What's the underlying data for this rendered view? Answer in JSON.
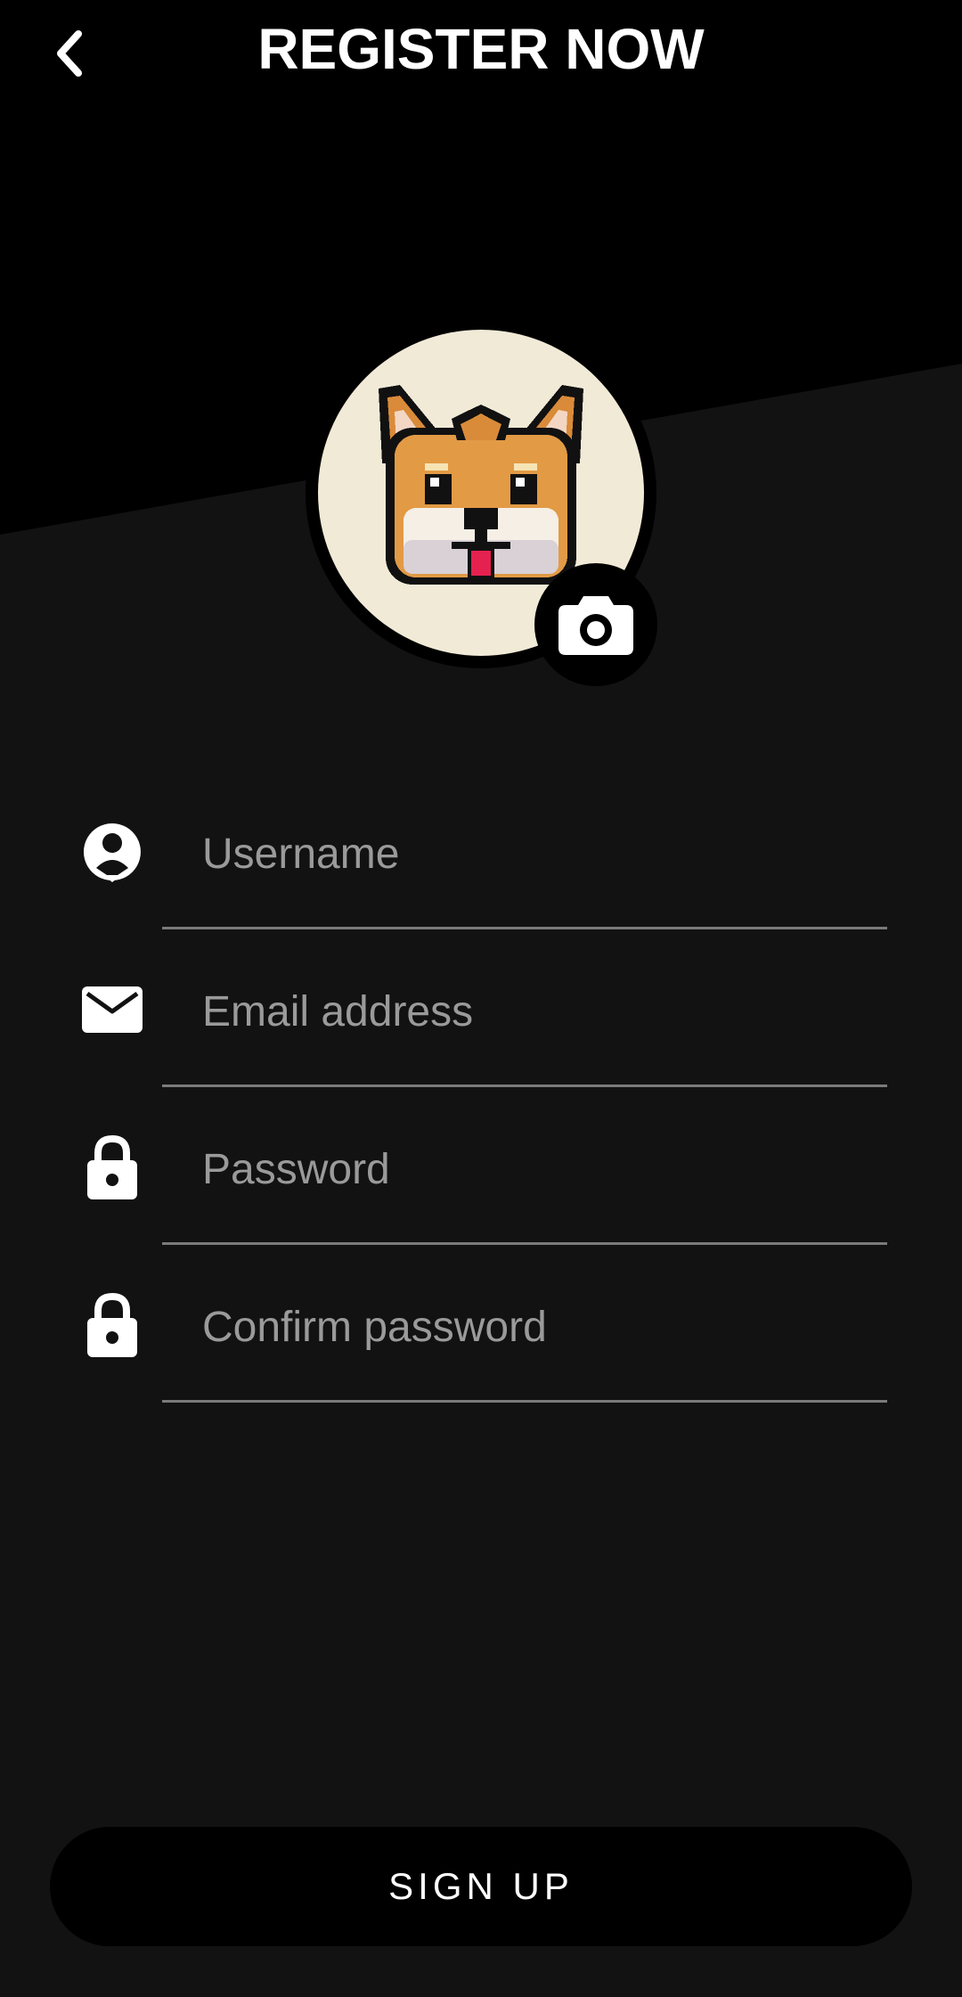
{
  "header": {
    "title": "REGISTER NOW",
    "back_icon": "chevron-left-icon"
  },
  "avatar": {
    "image": "shiba-dog-pixel-art",
    "edit_icon": "camera-icon"
  },
  "form": {
    "fields": [
      {
        "name": "username",
        "icon": "user-icon",
        "placeholder": "Username",
        "value": ""
      },
      {
        "name": "email",
        "icon": "mail-icon",
        "placeholder": "Email address",
        "value": ""
      },
      {
        "name": "password",
        "icon": "lock-icon",
        "placeholder": "Password",
        "value": ""
      },
      {
        "name": "confirm_password",
        "icon": "lock-icon",
        "placeholder": "Confirm password",
        "value": ""
      }
    ]
  },
  "signup": {
    "label": "SIGN UP"
  },
  "colors": {
    "background": "#121212",
    "header_background": "#000000",
    "text": "#ffffff",
    "placeholder": "#9a9a9a",
    "avatar_background": "#f1ead7"
  }
}
